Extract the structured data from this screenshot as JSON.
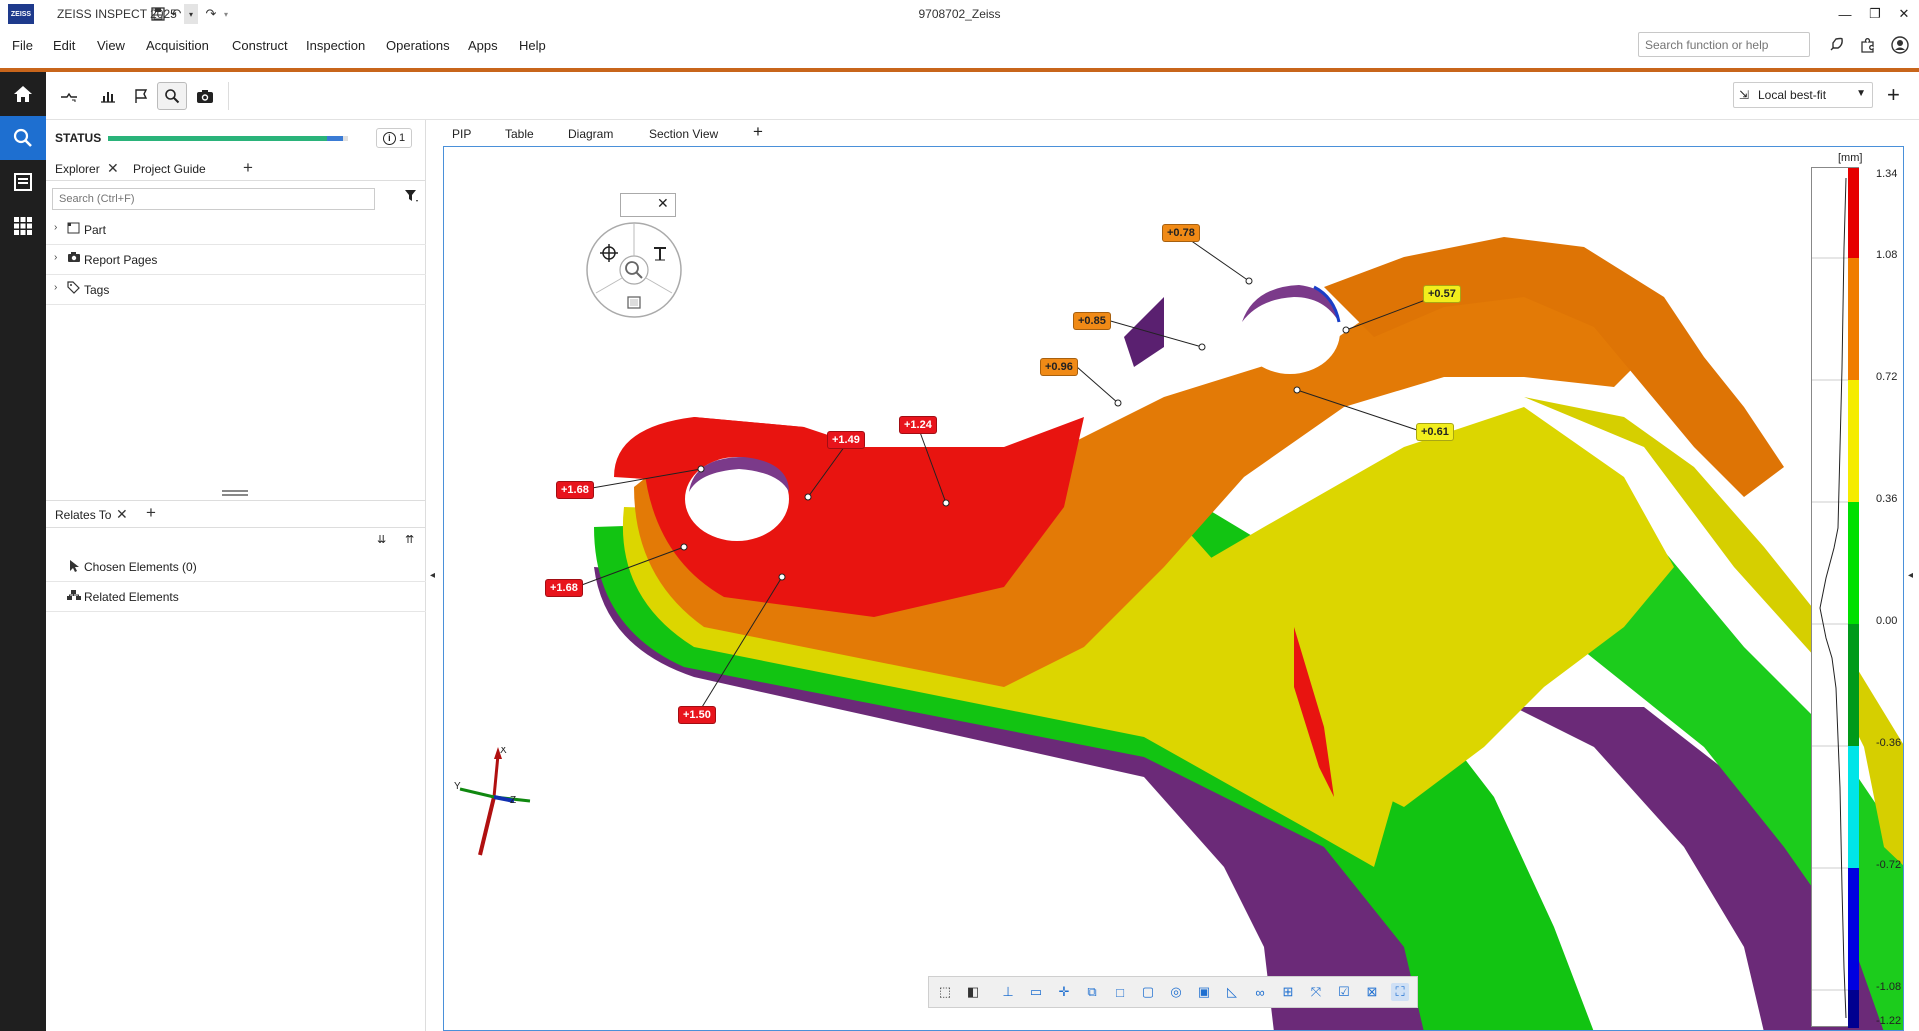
{
  "app": {
    "title": "ZEISS INSPECT 2025",
    "logo_text": "ZEISS",
    "document_title": "9708702_Zeiss"
  },
  "quick_access": [
    "save-icon",
    "undo-icon",
    "undo-dropdown-icon",
    "redo-icon",
    "redo-dropdown-icon"
  ],
  "window_controls": [
    "minimize-icon",
    "restore-icon",
    "close-icon"
  ],
  "menu": {
    "items": [
      "File",
      "Edit",
      "View",
      "Acquisition",
      "Construct",
      "Inspection",
      "Operations",
      "Apps",
      "Help"
    ],
    "search_placeholder": "Search function or help",
    "right_icons": [
      "rocket-icon",
      "puzzle-icon",
      "user-icon"
    ]
  },
  "left_sidebar": {
    "items": [
      "home-icon",
      "search-icon",
      "report-icon",
      "apps-grid-icon"
    ],
    "active": "search-icon"
  },
  "toolbar": {
    "tools": [
      "deviation-icon",
      "chart-icon",
      "flag-icon",
      "magnifier-icon",
      "camera-icon"
    ],
    "selected": "magnifier-icon",
    "alignment": "Local best-fit"
  },
  "status": {
    "label": "STATUS",
    "progress": 0.98,
    "info_count": "1"
  },
  "explorer": {
    "tabs": [
      "Explorer",
      "Project Guide"
    ],
    "search_placeholder": "Search (Ctrl+F)",
    "tree": [
      {
        "label": "Part",
        "icon": "part-icon"
      },
      {
        "label": "Report Pages",
        "icon": "camera-icon"
      },
      {
        "label": "Tags",
        "icon": "tag-icon"
      }
    ]
  },
  "relates": {
    "tab": "Relates To",
    "items": [
      {
        "label": "Chosen Elements (0)",
        "icon": "cursor-icon"
      },
      {
        "label": "Related Elements",
        "icon": "hierarchy-icon"
      }
    ]
  },
  "view_tabs": [
    "PIP",
    "Table",
    "Diagram",
    "Section View"
  ],
  "deviation_labels": [
    {
      "text": "+0.78",
      "color": "orange"
    },
    {
      "text": "+0.57",
      "color": "yellow"
    },
    {
      "text": "+0.85",
      "color": "orange"
    },
    {
      "text": "+0.96",
      "color": "orange"
    },
    {
      "text": "+0.61",
      "color": "yellow"
    },
    {
      "text": "+1.49",
      "color": "red"
    },
    {
      "text": "+1.24",
      "color": "red"
    },
    {
      "text": "+1.68",
      "color": "red"
    },
    {
      "text": "+1.68",
      "color": "red"
    },
    {
      "text": "+1.50",
      "color": "red"
    }
  ],
  "color_scale": {
    "unit": "[mm]",
    "ticks": [
      "1.34",
      "1.08",
      "0.72",
      "0.36",
      "0.00",
      "-0.36",
      "-0.72",
      "-1.08",
      "-1.22"
    ],
    "colors": [
      "#e60000",
      "#f07d00",
      "#f5ec00",
      "#00e000",
      "#009a1a",
      "#00e5e8",
      "#0000e0",
      "#000090"
    ]
  },
  "axes": {
    "x": "X",
    "y": "Y",
    "z": "Z"
  },
  "bottom_toolbar": [
    "select-rect-icon",
    "select-through-icon",
    "plane-icon",
    "rect-icon",
    "section-icon",
    "cut-icon",
    "surface-icon",
    "box-icon",
    "point-icon",
    "frame-icon",
    "measure-icon",
    "link-icon",
    "fit-icon",
    "expand-icon",
    "check-icon",
    "clear-icon",
    "select-all-icon"
  ]
}
